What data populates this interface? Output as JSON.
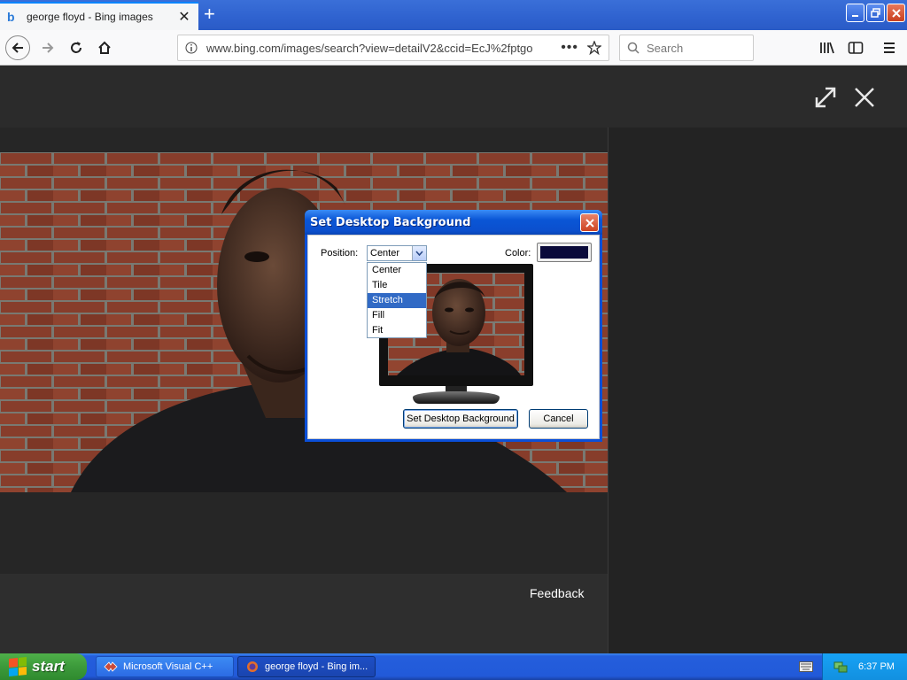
{
  "browser": {
    "tab_title": "george floyd - Bing images",
    "url": "www.bing.com/images/search?view=detailV2&ccid=EcJ%2fptgo",
    "search_placeholder": "Search"
  },
  "page": {
    "feedback_label": "Feedback"
  },
  "dialog": {
    "title": "Set Desktop Background",
    "position_label": "Position:",
    "position_value": "Center",
    "color_label": "Color:",
    "color_value": "#0a0a3a",
    "options": [
      "Center",
      "Tile",
      "Stretch",
      "Fill",
      "Fit"
    ],
    "selected_option": "Stretch",
    "set_button": "Set Desktop Background",
    "cancel_button": "Cancel"
  },
  "taskbar": {
    "start_label": "start",
    "tasks": [
      {
        "label": "Microsoft Visual C++"
      },
      {
        "label": "george floyd - Bing im..."
      }
    ],
    "clock": "6:37 PM"
  },
  "colors": {
    "titlebar_blue": "#0a56d6",
    "selection_blue": "#316ac5",
    "start_green": "#3c9a3b",
    "page_bg": "#2b2b2b"
  }
}
